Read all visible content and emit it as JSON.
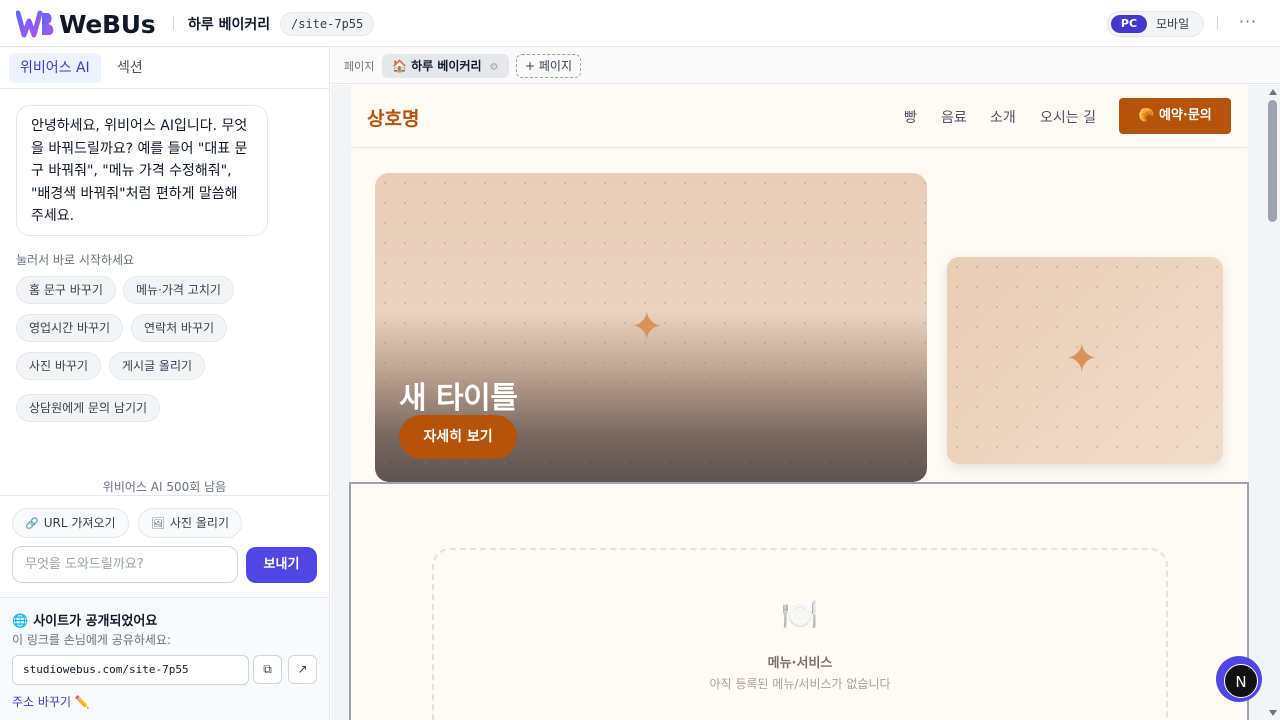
{
  "app": {
    "logo_text": "WeBUs",
    "site_name": "하루 베이커리",
    "site_path": "/site-7p55",
    "device": {
      "pc_label": "PC",
      "mobile_label": "모바일",
      "selected": "PC"
    },
    "more_label": "···"
  },
  "sidebar": {
    "tabs": [
      {
        "label": "위비어스 AI",
        "active": true
      },
      {
        "label": "섹션",
        "active": false
      }
    ],
    "assistant_message": "안녕하세요, 위비어스 AI입니다. 무엇을 바꿔드릴까요? 예를 들어 \"대표 문구 바꿔줘\", \"메뉴 가격 수정해줘\", \"배경색 바꿔줘\"처럼 편하게 말씀해 주세요.",
    "quick_label": "눌러서 바로 시작하세요",
    "quick_actions": [
      "홈 문구 바꾸기",
      "메뉴·가격 고치기",
      "영업시간 바꾸기",
      "연락처 바꾸기",
      "사진 바꾸기",
      "게시글 올리기",
      "상담원에게 문의 남기기"
    ],
    "quota": "위비어스 AI 500회 남음",
    "tools": {
      "url_import": "URL 가져오기",
      "photo_upload": "사진 올리기",
      "url_icon": "link-icon",
      "photo_icon": "image-icon"
    },
    "input_placeholder": "무엇을 도와드릴까요?",
    "send_label": "보내기",
    "publish": {
      "title": "사이트가 공개되었어요",
      "subtitle": "이 링크를 손님에게 공유하세요:",
      "url": "studiowebus.com/site-7p55",
      "copy_icon": "⧉",
      "open_icon": "↗",
      "change_address": "주소 바꾸기",
      "change_icon": "✏️"
    }
  },
  "pages_bar": {
    "label": "페이지",
    "current_page": "🏠 하루 베이커리",
    "settings_icon": "⚙",
    "add_page": "+ 페이지"
  },
  "preview": {
    "brand": "상호명",
    "nav": [
      "빵",
      "음료",
      "소개",
      "오시는 길"
    ],
    "cta": "🥐 예약·문의",
    "hero_title": "새 타이틀",
    "hero_button": "자세히 보기",
    "empty_section": {
      "icon": "🍽️",
      "title": "메뉴·서비스",
      "subtitle": "아직 등록된 메뉴/서비스가 없습니다"
    }
  },
  "fab": {
    "label": "N"
  },
  "colors": {
    "accent": "#4f46e5",
    "brand": "#b45309",
    "site_bg": "#fffaf4"
  }
}
